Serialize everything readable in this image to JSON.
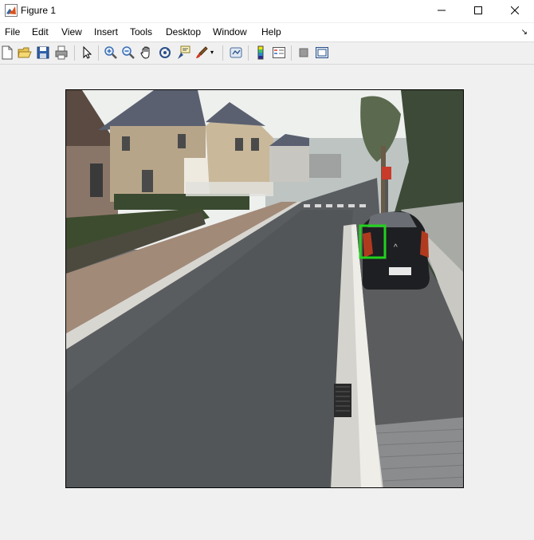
{
  "window": {
    "title": "Figure 1",
    "minimize_icon": "minimize-icon",
    "maximize_icon": "maximize-icon",
    "close_icon": "close-icon"
  },
  "menu": {
    "items": [
      "File",
      "Edit",
      "View",
      "Insert",
      "Tools",
      "Desktop",
      "Window",
      "Help"
    ]
  },
  "toolbar": {
    "buttons": [
      "new-figure-icon",
      "open-file-icon",
      "save-figure-icon",
      "print-figure-icon",
      "edit-plot-icon",
      "zoom-in-icon",
      "zoom-out-icon",
      "pan-icon",
      "rotate-3d-icon",
      "data-cursor-icon",
      "brush-icon",
      "link-plot-icon",
      "insert-colorbar-icon",
      "insert-legend-icon",
      "hide-plot-tools-icon",
      "show-plot-tools-icon"
    ]
  },
  "figure": {
    "image": "street-scene-photo",
    "detection_box_color": "#22d21e"
  }
}
